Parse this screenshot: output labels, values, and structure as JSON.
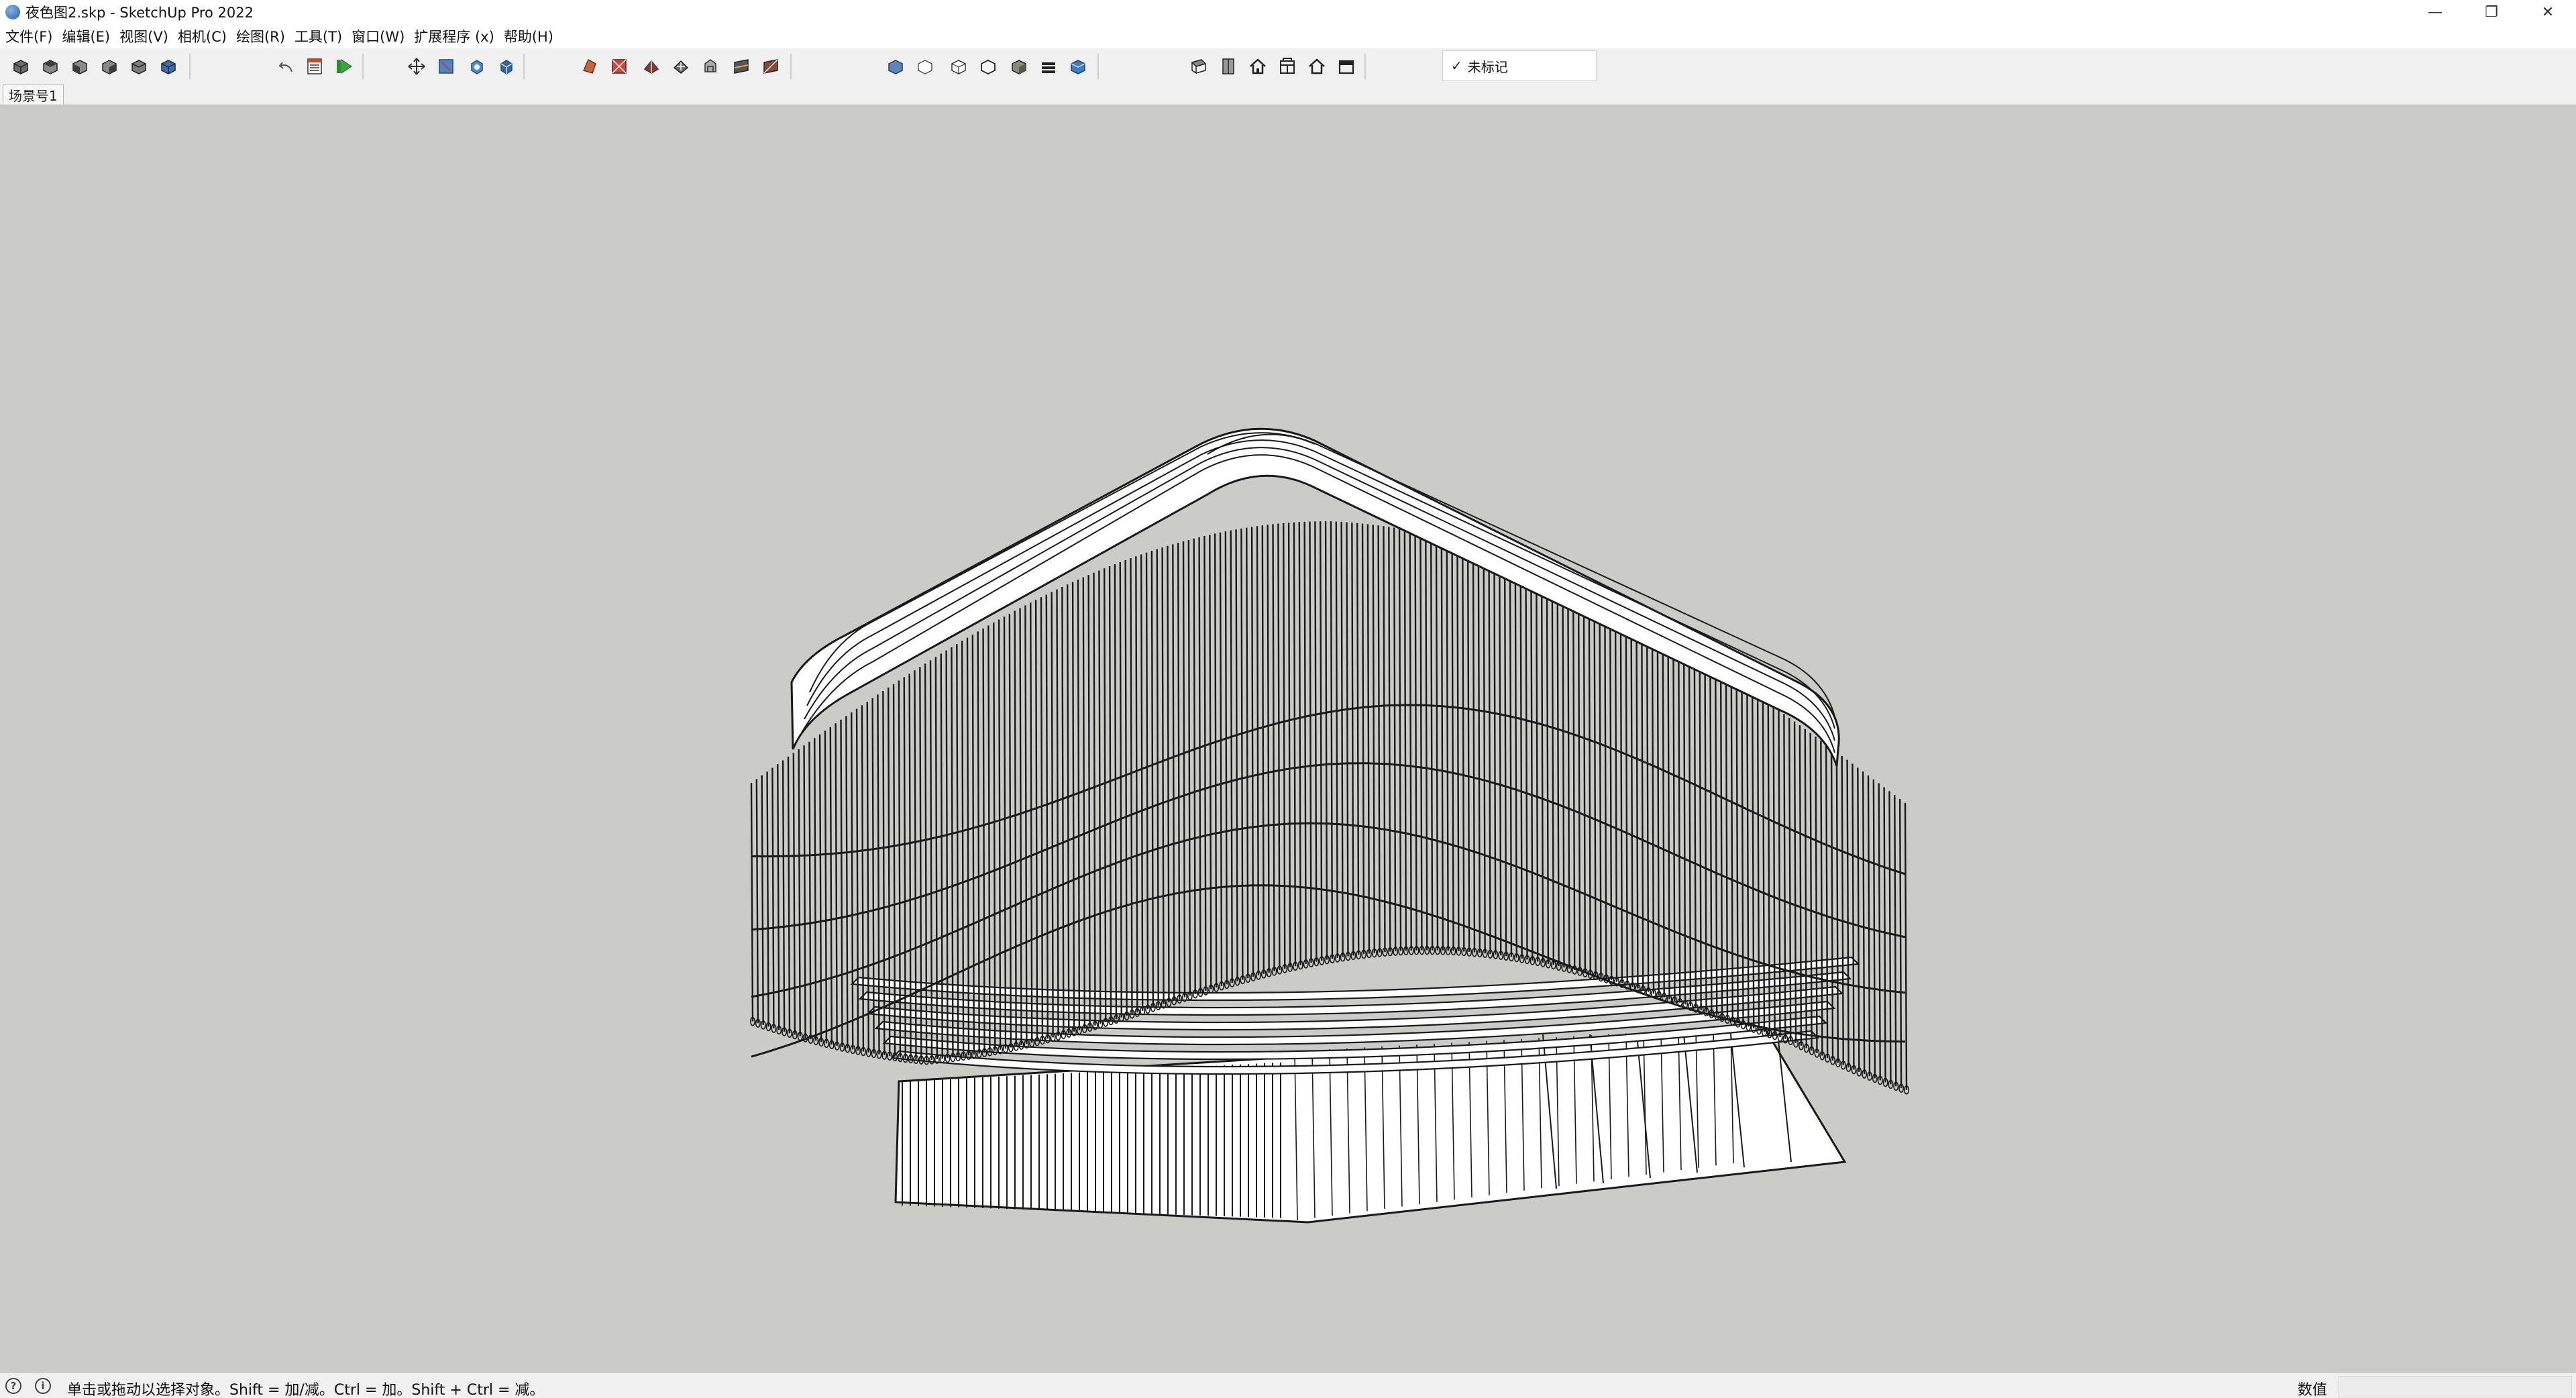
{
  "window": {
    "title": "夜色图2.skp - SketchUp Pro 2022",
    "controls": {
      "minimize": "—",
      "restore": "❐",
      "close": "✕"
    }
  },
  "menu": {
    "items": [
      "文件(F)",
      "编辑(E)",
      "视图(V)",
      "相机(C)",
      "绘图(R)",
      "工具(T)",
      "窗口(W)",
      "扩展程序 (x)",
      "帮助(H)"
    ]
  },
  "toolbar": {
    "icons": [
      "box-front-icon",
      "box-top-icon",
      "box-right-icon",
      "box-back-icon",
      "box-left-icon",
      "box-iso-icon",
      "undo-icon",
      "outliner-icon",
      "play-scene-icon",
      "orbit-icon",
      "zoom-extents-icon",
      "walk-icon",
      "view-3d-icon",
      "paint-icon",
      "eraser-icon",
      "pushpull-icon",
      "move-icon",
      "rotate-icon",
      "section-icon",
      "section-display-icon",
      "style-xray-icon",
      "style-wire-icon",
      "style-hidden-icon",
      "style-outline-icon",
      "style-shaded-icon",
      "style-textured-icon",
      "style-mono-icon",
      "component-icon",
      "layers-icon",
      "home-icon",
      "warehouse-icon",
      "house-icon",
      "share-icon"
    ],
    "tag": {
      "check": "✓",
      "label": "未标记"
    }
  },
  "scenes": {
    "active": "场景号1"
  },
  "status": {
    "help_glyph": "?",
    "info_glyph": "i",
    "hint": "单击或拖动以选择对象。Shift = 加/减。Ctrl = 加。Shift + Ctrl = 减。",
    "measurements_label": "数值",
    "measurements_value": ""
  },
  "colors": {
    "viewport_bg": "#cbccc6",
    "model_fill": "#ffffff",
    "model_edge": "#1a1a1a"
  }
}
